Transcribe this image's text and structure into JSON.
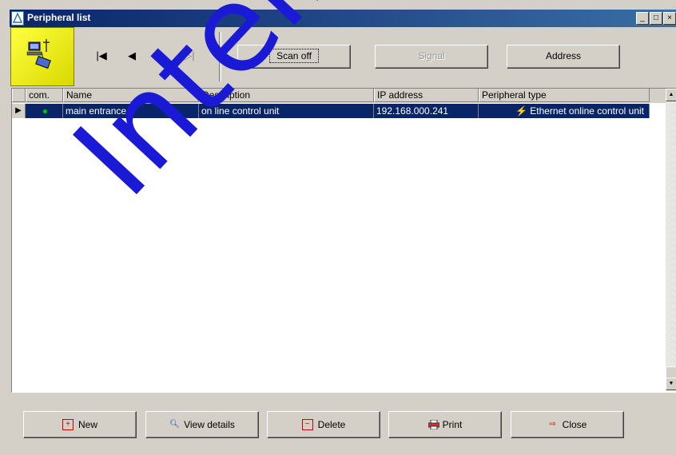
{
  "window": {
    "title": "Peripheral list",
    "minimize": "_",
    "maximize": "□",
    "close": "×"
  },
  "toolbar": {
    "nav": {
      "first": "|◀",
      "prev": "◀",
      "next": "▷",
      "last": "▷|"
    },
    "scan_label": "Scan off",
    "signal_label": "Signal",
    "address_label": "Address"
  },
  "table": {
    "columns": [
      "com.",
      "Name",
      "Description",
      "IP address",
      "Peripheral type"
    ],
    "rows": [
      {
        "status": "●",
        "name": "main entrance",
        "description": "on line control unit",
        "ip": "192.168.000.241",
        "type": "Ethernet online control unit"
      }
    ],
    "status_color": "#00c000"
  },
  "buttons": {
    "new_label": "New",
    "view_label": "View details",
    "delete_label": "Delete",
    "print_label": "Print",
    "close_label": "Close"
  },
  "watermark": "Intelligent Security"
}
